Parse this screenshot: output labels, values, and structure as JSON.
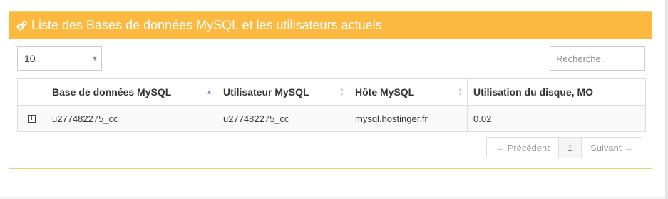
{
  "panel": {
    "title": "Liste des Bases de données MySQL et les utilisateurs actuels",
    "accent": "#fbb93f"
  },
  "length_select": {
    "value": "10",
    "arrow": "▼"
  },
  "search": {
    "placeholder": "Recherche.."
  },
  "table": {
    "columns": [
      "",
      "Base de données MySQL",
      "Utilisateur MySQL",
      "Hôte MySQL",
      "Utilisation du disque, MO"
    ],
    "rows": [
      {
        "expand": "+",
        "database": "u277482275_cc",
        "user": "u277482275_cc",
        "host": "mysql.hostinger.fr",
        "disk_usage": "0.02"
      }
    ]
  },
  "pagination": {
    "previous": "← Précédent",
    "page": "1",
    "next": "Suivant →"
  }
}
